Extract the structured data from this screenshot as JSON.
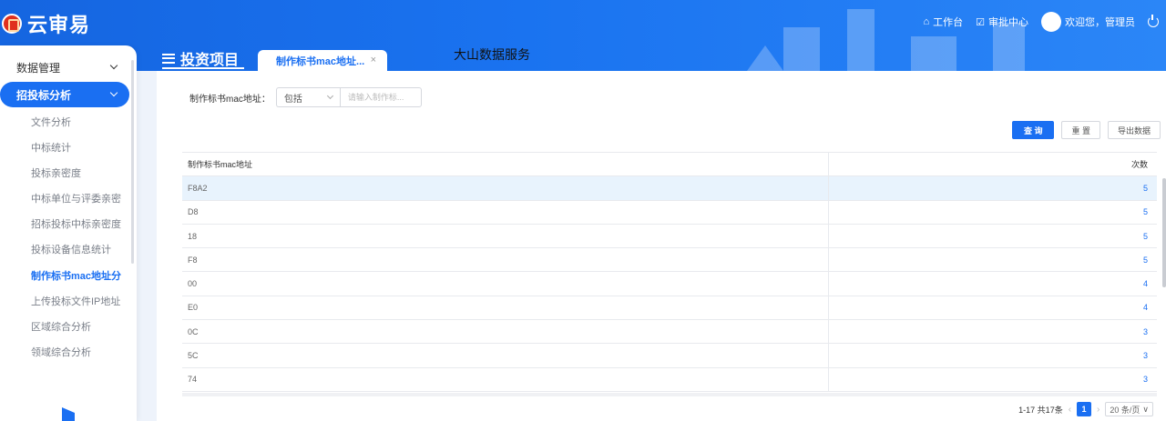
{
  "app": {
    "title": "云审易"
  },
  "header": {
    "workbench": "工作台",
    "approval": "审批中心",
    "welcome": "欢迎您，管理员"
  },
  "sidebar": {
    "groups": [
      {
        "label": "数据管理",
        "expanded": false
      },
      {
        "label": "招投标分析",
        "expanded": true,
        "active": true
      }
    ],
    "items": [
      {
        "label": "文件分析"
      },
      {
        "label": "中标统计"
      },
      {
        "label": "投标亲密度"
      },
      {
        "label": "中标单位与评委亲密"
      },
      {
        "label": "招标投标中标亲密度"
      },
      {
        "label": "投标设备信息统计"
      },
      {
        "label": "制作标书mac地址分",
        "active": true
      },
      {
        "label": "上传投标文件IP地址"
      },
      {
        "label": "区域综合分析"
      },
      {
        "label": "领域综合分析"
      }
    ]
  },
  "section": {
    "title": "投资项目"
  },
  "tab": {
    "label": "制作标书mac地址...",
    "close": "×"
  },
  "watermark": "大山数据服务",
  "filter": {
    "label": "制作标书mac地址：",
    "operator": "包括",
    "placeholder": "请输入制作标..."
  },
  "buttons": {
    "query": "查 询",
    "reset": "重 置",
    "export": "导出数据"
  },
  "table": {
    "headers": [
      "制作标书mac地址",
      "次数"
    ],
    "rows": [
      {
        "mac": "F8A2",
        "count": "5"
      },
      {
        "mac": "D8",
        "count": "5"
      },
      {
        "mac": "18",
        "count": "5"
      },
      {
        "mac": "F8",
        "count": "5"
      },
      {
        "mac": "00",
        "count": "4"
      },
      {
        "mac": "E0",
        "count": "4"
      },
      {
        "mac": "0C",
        "count": "3"
      },
      {
        "mac": "5C",
        "count": "3"
      },
      {
        "mac": "74",
        "count": "3"
      }
    ]
  },
  "pagination": {
    "summary": "1-17 共17条",
    "current": "1",
    "page_size": "20 条/页"
  },
  "colors": {
    "primary": "#1a6ff2",
    "header_bg": "#1565e0",
    "row_highlight": "#e8f3fd"
  }
}
